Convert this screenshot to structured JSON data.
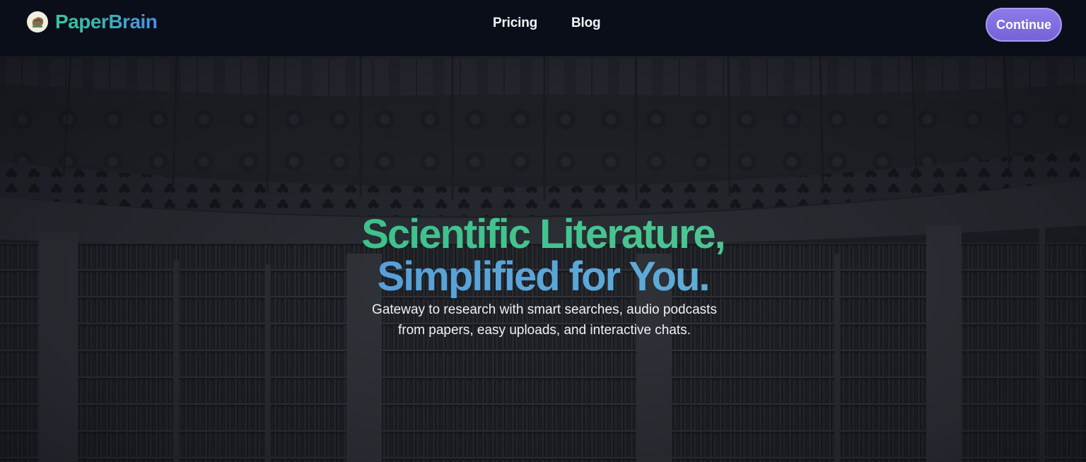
{
  "brand": {
    "name": "PaperBrain",
    "logo_icon": "brain-icon",
    "gradient": [
      "#3ac59a",
      "#4a8fe6"
    ]
  },
  "nav": {
    "items": [
      {
        "label": "Pricing"
      },
      {
        "label": "Blog"
      }
    ]
  },
  "cta": {
    "label": "Continue",
    "color": "#7f6fe2"
  },
  "hero": {
    "headline_line1": "Scientific Literature,",
    "headline_line2": "Simplified for You.",
    "subtitle": "Gateway to research with smart searches, audio podcasts from papers, easy uploads, and interactive chats.",
    "background": "library-dome-image",
    "line1_color": "#3ec28c",
    "line2_color": "#5aa6d9"
  }
}
